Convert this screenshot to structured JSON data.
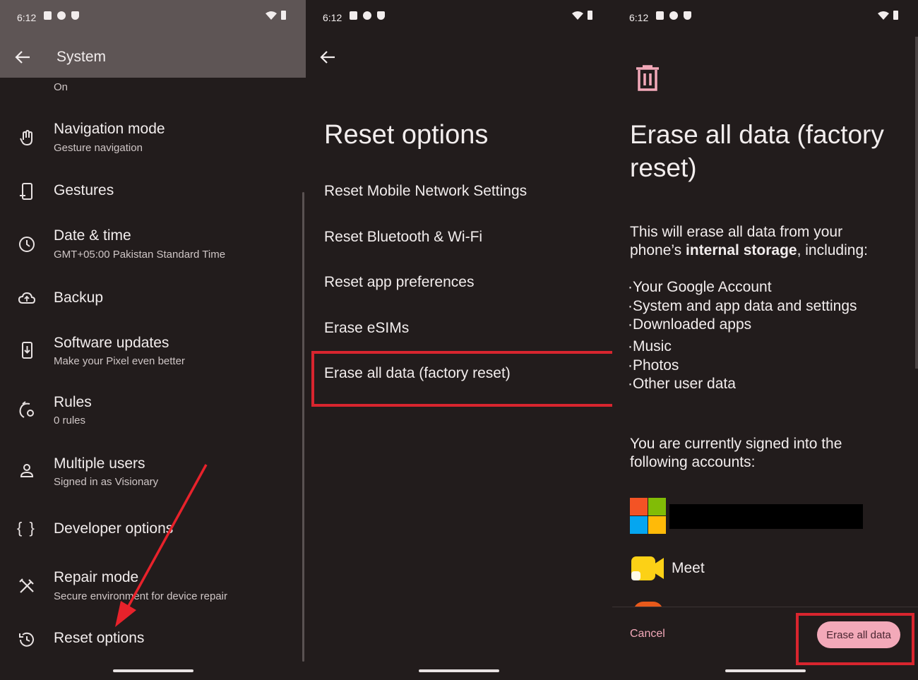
{
  "status_bar": {
    "time": "6:12"
  },
  "panel1": {
    "title": "System",
    "top_partial_value": "On",
    "items": [
      {
        "title": "Navigation mode",
        "subtitle": "Gesture navigation",
        "icon": "gesture-hand-icon"
      },
      {
        "title": "Gestures",
        "subtitle": "",
        "icon": "phone-gesture-icon"
      },
      {
        "title": "Date & time",
        "subtitle": "GMT+05:00 Pakistan Standard Time",
        "icon": "clock-icon"
      },
      {
        "title": "Backup",
        "subtitle": "",
        "icon": "cloud-upload-icon"
      },
      {
        "title": "Software updates",
        "subtitle": "Make your Pixel even better",
        "icon": "system-update-icon"
      },
      {
        "title": "Rules",
        "subtitle": "0 rules",
        "icon": "rules-icon"
      },
      {
        "title": "Multiple users",
        "subtitle": "Signed in as Visionary",
        "icon": "person-icon"
      },
      {
        "title": "Developer options",
        "subtitle": "",
        "icon": "braces-icon"
      },
      {
        "title": "Repair mode",
        "subtitle": "Secure environment for device repair",
        "icon": "tools-icon"
      },
      {
        "title": "Reset options",
        "subtitle": "",
        "icon": "history-icon"
      }
    ]
  },
  "panel2": {
    "title": "Reset options",
    "options": [
      "Reset Mobile Network Settings",
      "Reset Bluetooth & Wi-Fi",
      "Reset app preferences",
      "Erase eSIMs",
      "Erase all data (factory reset)"
    ]
  },
  "panel3": {
    "title_line1": "Erase all data (factory",
    "title_line2": "reset)",
    "intro_line1": "This will erase all data from your",
    "intro_pre": "phone’s ",
    "intro_bold": "internal storage",
    "intro_post": ", including:",
    "bullets": [
      "Your Google Account",
      "System and app data and settings",
      "Downloaded apps",
      "Music",
      "Photos",
      "Other user data"
    ],
    "accounts_line1": "You are currently signed into the",
    "accounts_line2": "following accounts:",
    "accounts": [
      {
        "name": "",
        "icon": "microsoft-logo-icon"
      },
      {
        "name": "Meet",
        "icon": "meet-logo-icon"
      }
    ],
    "cancel_label": "Cancel",
    "erase_button_label": "Erase all data"
  },
  "colors": {
    "background": "#221c1c",
    "accent_pink": "#f3a9b9",
    "highlight_red": "#d8252e",
    "annotation_arrow": "#e8222b"
  }
}
